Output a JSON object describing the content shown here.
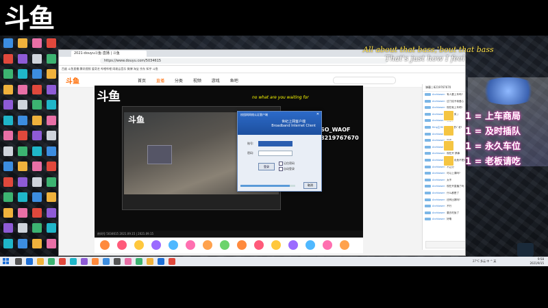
{
  "stream": {
    "logo": "斗鱼",
    "overlay_line1": "All about that bass,'bout that bass",
    "overlay_line2": "That's just how I feel"
  },
  "browser": {
    "tab_title": "2021-douyu斗鱼-直播 | 斗鱼",
    "url": "https://www.douyu.com/5034615",
    "site_title": "国内最大型直播平台有限公司",
    "bookmarks": "百度  斗鱼直播  腾讯视频  爱奇艺  哔哩哔哩  网易云音乐  微博  淘宝  京东  知乎  斗鱼",
    "site_logo": "斗鱼",
    "nav": [
      "首页",
      "直播",
      "分类",
      "视频",
      "游戏",
      "鱼吧"
    ],
    "nav_active_index": 1
  },
  "player": {
    "logo": "斗鱼",
    "caption": "no what are you waiting for",
    "room_label": "SO_WAOF",
    "room_number": "8219767670",
    "footer": "房间号 5034615   2021.09.15 | 2021.09.15"
  },
  "dialog": {
    "title": "校园网网络认证客户端",
    "brand_line1": "世纪上网客户端",
    "brand_line2": "Broadband Internet Client",
    "label_account": "账号:",
    "label_password": "密码:",
    "login_label": "登录",
    "remember_label": "记住密码",
    "auto_label": "自动登录",
    "cancel_label": "取消",
    "progress": 0.9
  },
  "chat": {
    "header": "弹幕 | 8219767670",
    "messages": [
      {
        "user": "Archlower:",
        "text": "有人要上车吗?"
      },
      {
        "user": "Archlower:",
        "text": "过门给予我爱心"
      },
      {
        "user": "Archlower:",
        "text": "现在就上车吧!"
      },
      {
        "user": "Archlower:",
        "text": "斗鱼太美了"
      },
      {
        "user": "Archlower:",
        "text": "我走了"
      },
      {
        "user": "King主Hit:",
        "text": "以为就是爸爸?"
      },
      {
        "user": "Archlower:",
        "text": "好"
      },
      {
        "user": "Archlower:",
        "text": "加油"
      },
      {
        "user": "Archlower:",
        "text": "不会吧"
      },
      {
        "user": "Archlower:",
        "text": "现在开 搞事"
      },
      {
        "user": "Archlower:",
        "text": "现在我说是不是大家了 好个"
      },
      {
        "user": "Archlower:",
        "text": "不过分"
      },
      {
        "user": "Archlower:",
        "text": "可以上课吗?"
      },
      {
        "user": "Archlower:",
        "text": "太不"
      },
      {
        "user": "Archlower:",
        "text": "现在开直播了吗 不对"
      },
      {
        "user": "Archlower:",
        "text": "什么都是了"
      },
      {
        "user": "Archlower:",
        "text": "还有比赛吗?"
      },
      {
        "user": "Archlower:",
        "text": "不行"
      },
      {
        "user": "Archlower:",
        "text": "要去吃饭了"
      },
      {
        "user": "Archlower:",
        "text": "好嘞"
      }
    ]
  },
  "right_panel": {
    "items": [
      {
        "icon": "car-icon",
        "count": "1",
        "text": "上车商局"
      },
      {
        "icon": "car-icon",
        "count": "1",
        "text": "及时插队"
      },
      {
        "icon": "car-icon",
        "count": "1",
        "text": "永久车位"
      },
      {
        "icon": "car-icon",
        "count": "1",
        "text": "老板请吃"
      }
    ],
    "x_label": "x"
  },
  "taskbar": {
    "time": "9:58",
    "date": "2021/9/15",
    "tray": "27°C 多云 中 ^ 英"
  },
  "colors": {
    "accent": "#ff6a00",
    "overlay_yellow": "#ffe14a",
    "overlay_glow": "#d83aa8"
  }
}
